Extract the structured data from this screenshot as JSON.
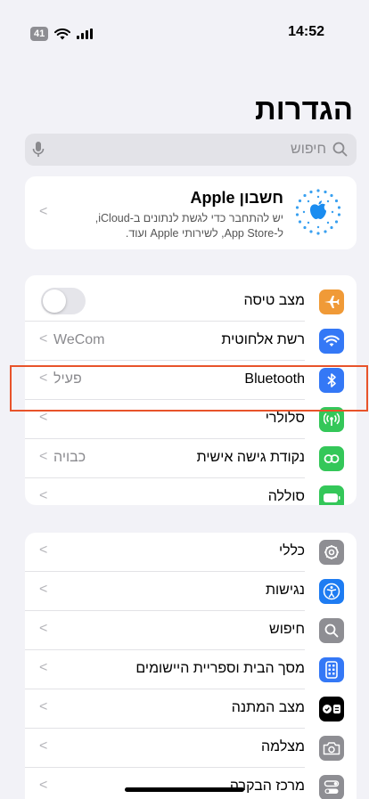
{
  "status_bar": {
    "battery": "41",
    "time": "14:52"
  },
  "page_title": "הגדרות",
  "search": {
    "placeholder": "חיפוש"
  },
  "apple_account": {
    "title": "חשבון Apple",
    "subtitle_line1": "יש להתחבר כדי לגשת לנתונים ב-iCloud,",
    "subtitle_line2": "ל-App Store, לשירותי Apple ועוד."
  },
  "connectivity_group": [
    {
      "label": "מצב טיסה",
      "value": "",
      "icon": "airplane-icon",
      "color": "#f09a37",
      "control": "toggle",
      "toggle_on": false
    },
    {
      "label": "רשת אלחוטית",
      "value": "WeCom",
      "icon": "wifi-icon",
      "color": "#3478f6",
      "control": "chevron"
    },
    {
      "label": "Bluetooth",
      "value": "פעיל",
      "icon": "bluetooth-icon",
      "color": "#3478f6",
      "control": "chevron"
    },
    {
      "label": "סלולרי",
      "value": "",
      "icon": "cellular-icon",
      "color": "#34c759",
      "control": "chevron"
    },
    {
      "label": "נקודת גישה אישית",
      "value": "כבויה",
      "icon": "hotspot-icon",
      "color": "#34c759",
      "control": "chevron"
    },
    {
      "label": "סוללה",
      "value": "",
      "icon": "battery-icon",
      "color": "#34c759",
      "control": "chevron"
    }
  ],
  "general_group": [
    {
      "label": "כללי",
      "icon": "gear-icon",
      "color": "#8e8e93"
    },
    {
      "label": "נגישות",
      "icon": "accessibility-icon",
      "color": "#1e7cf2"
    },
    {
      "label": "חיפוש",
      "icon": "search-icon",
      "color": "#8e8e93"
    },
    {
      "label": "מסך הבית וספריית היישומים",
      "icon": "home-screen-icon",
      "color": "#3478f6"
    },
    {
      "label": "מצב המתנה",
      "icon": "standby-icon",
      "color": "#000000"
    },
    {
      "label": "מצלמה",
      "icon": "camera-icon",
      "color": "#8e8e93"
    },
    {
      "label": "מרכז הבקרה",
      "icon": "control-center-icon",
      "color": "#8e8e93"
    }
  ]
}
